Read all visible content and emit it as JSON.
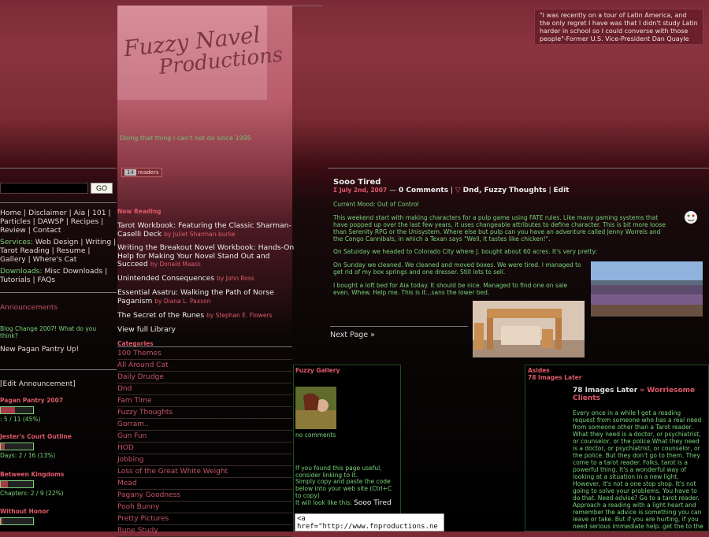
{
  "header": {
    "logo_line1": "Fuzzy Navel",
    "logo_line2": "Productions",
    "tagline": "Doing that thing I can't not do since 1995",
    "readers_count": "14",
    "readers_label": "readers"
  },
  "quote": "\"I was recently on a tour of Latin America, and the only regret I have was that I didn't study Latin harder in school so I could converse with those people\"-Former U.S. Vice-President Dan Quayle",
  "search": {
    "value": "",
    "button": "GO"
  },
  "nav": {
    "line1": [
      "Home",
      "Disclaimer",
      "Aia",
      "101"
    ],
    "line2": [
      "Particles",
      "DAWSP",
      "Recipes"
    ],
    "line3": [
      "Review",
      "Contact"
    ],
    "services_label": "Services:",
    "services": [
      "Web Design",
      "Writing",
      "Tarot Reading",
      "Resume",
      "Gallery",
      "Where's Cat"
    ],
    "downloads_label": "Downloads:",
    "downloads": [
      "Misc Downloads",
      "Tutorials",
      "FAQs"
    ]
  },
  "announcements": {
    "title": "Announcements",
    "item1": "Blog Change 2007! What do you think?",
    "item2": "New Pagan Pantry Up!",
    "edit": "[Edit Announcement]"
  },
  "progress": [
    {
      "title": "Pagan Pantry 2007",
      "text": ": 5 / 11 (45%)",
      "fraction": 0.45
    },
    {
      "title": "Jester's Court Outline",
      "text": "Days: 2 / 16 (13%)",
      "fraction": 0.13
    },
    {
      "title": "Between Kingdoms",
      "text": "Chapters: 2 / 9 (22%)",
      "fraction": 0.22
    },
    {
      "title": "Without Honor",
      "text": "",
      "fraction": 0.05
    }
  ],
  "now_reading": {
    "heading": "Now Reading",
    "books": [
      {
        "title": "Tarot Workbook: Featuring the Classic Sharman-Caselli Deck",
        "author": "by Juliet Sharman-burke"
      },
      {
        "title": "Writing the Breakout Novel Workbook: Hands-On Help for Making Your Novel Stand Out and Succeed",
        "author": "by Donald Maass"
      },
      {
        "title": "Unintended Consequences",
        "author": "by John Ross"
      },
      {
        "title": "Essential Asatru: Walking the Path of Norse Paganism",
        "author": "by Diana L. Paxson"
      },
      {
        "title": "The Secret of the Runes",
        "author": "by Stephan E. Flowers"
      }
    ],
    "library_link": "View full Library"
  },
  "categories": {
    "heading": "Categories",
    "items": [
      "100 Themes",
      "All Around Cat",
      "Daily Drudge",
      "Dnd",
      "Fam Time",
      "Fuzzy Thoughts",
      "Gorram..",
      "Gun Fun",
      "HOD",
      "Jobbing",
      "Loss of the Great White Weight",
      "Mead",
      "Pagany Goodness",
      "Pooh Bunny",
      "Pretty Pictures",
      "Rune Study"
    ]
  },
  "post": {
    "title": "Sooo Tired",
    "date": "July 2nd, 2007",
    "comments": "0 Comments",
    "categories": "Dnd, Fuzzy Thoughts",
    "edit": "Edit",
    "mood": "Current Mood: Out of Control",
    "p1": "This weekend start with making characters for a pulp game using FATE rules. Like many gaming systems that have popped up over the last few years, it uses changeable attributes to define character. This is bit more loose than Serenity RPG or the Unisystem. Where else but pulp can you have an adventure called Jenny Worrels and the Congo Cannibals, in which a Texan says \"Well, it tastes like chicken!\".",
    "p2": "On Saturday we headed to Colorado City where J. bought about 60 acres. It's very pretty:",
    "p3": "On Sunday we cleaned. We cleaned and moved boxes. We were tired. I managed to get rid of my box springs and one dresser. Still lots to sell.",
    "p4": "I bought a loft bed for Aia today. It should be nice. Managed to find one on sale even. Whew. Help me. This is it...sans the lower bed.",
    "next": "Next Page »"
  },
  "gallery": {
    "title": "Fuzzy Gallery",
    "no_comments": "no comments",
    "link_text1": "If you found this page useful, consider linking to it.",
    "link_text2": "Simply copy and paste the code below into your web site (Ctrl+C to copy)",
    "link_text3": "It will look like this:",
    "link_preview": "Sooo Tired",
    "code": "<a href=\"http://www.fnproductions.ne"
  },
  "asides": {
    "title": "Asides",
    "subtitle": "78 Images Later",
    "headline_a": "78 Images Later",
    "headline_b": "» Worriesome Clients",
    "body": "Every once in a while I get a reading request from someone who has a real need from someone other than a Tarot reader. What they need is a doctor, or psychiatrist, or counselor, or the police.What they need is a doctor, or psychiatrist, or counselor, or the police. But they don't go to them. They come to a tarot reader. Folks, tarot is a powerful thing. It's a wonderful way of looking at a situation in a new light. However, it's not a one stop shop. It's not going to solve your problems. You have to do that. Need advise? Go to a tarot reader. Approach a reading with a light heart and remember the advice is something you can leave or take. But if you are hurting, if you need serious immediate help..get the to the"
  }
}
